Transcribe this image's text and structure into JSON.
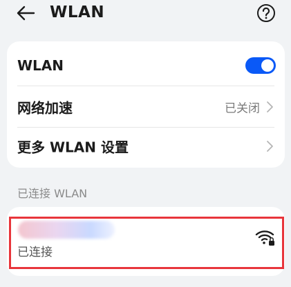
{
  "header": {
    "title": "WLAN"
  },
  "settings": {
    "items": [
      {
        "label": "WLAN",
        "toggle_on": true
      },
      {
        "label": "网络加速",
        "value": "已关闭"
      },
      {
        "label": "更多 WLAN 设置"
      }
    ]
  },
  "connected_section": {
    "label": "已连接 WLAN",
    "network": {
      "status": "已连接",
      "secured": true
    }
  },
  "colors": {
    "accent": "#0a59f7",
    "highlight": "#e8353b",
    "background": "#f1f3f5"
  },
  "icons": [
    "back-arrow-icon",
    "help-icon",
    "chevron-right-icon",
    "wifi-lock-icon"
  ]
}
